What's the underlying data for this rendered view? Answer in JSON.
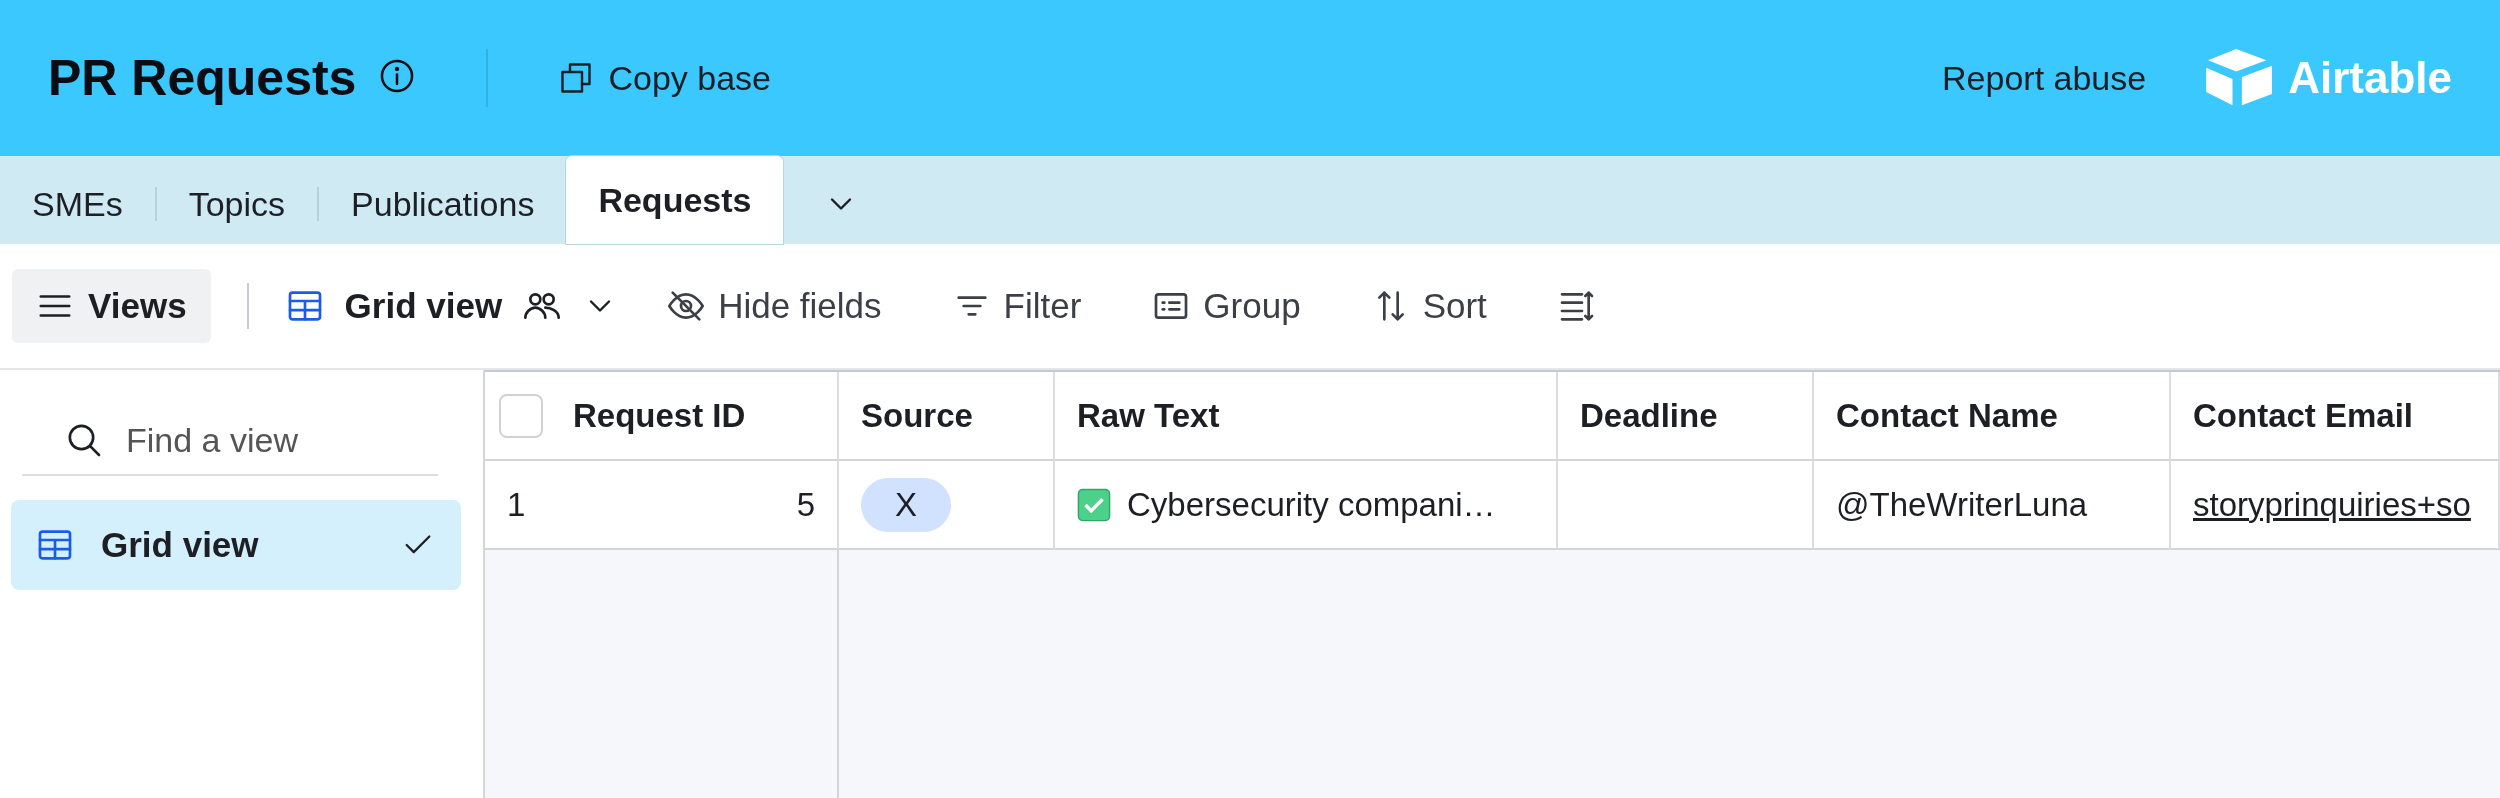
{
  "header": {
    "title": "PR Requests",
    "copy_base": "Copy base",
    "report_abuse": "Report abuse",
    "logo_text": "Airtable"
  },
  "tables": [
    {
      "label": "SMEs",
      "selected": false
    },
    {
      "label": "Topics",
      "selected": false
    },
    {
      "label": "Publications",
      "selected": false
    },
    {
      "label": "Requests",
      "selected": true
    }
  ],
  "toolbar": {
    "views_button": "Views",
    "view_name": "Grid view",
    "items": [
      {
        "kind": "hide",
        "label": "Hide fields"
      },
      {
        "kind": "filter",
        "label": "Filter"
      },
      {
        "kind": "group",
        "label": "Group"
      },
      {
        "kind": "sort",
        "label": "Sort"
      },
      {
        "kind": "row_height"
      }
    ]
  },
  "sidebar": {
    "search_placeholder": "Find a view",
    "views": [
      {
        "label": "Grid view",
        "selected": true
      }
    ]
  },
  "table": {
    "select_all_checked": false,
    "columns": [
      "Request ID",
      "Source",
      "Raw Text",
      "Deadline",
      "Contact Name",
      "Contact Email"
    ],
    "rows": [
      {
        "row_number": "1",
        "request_id": "5",
        "source": "X",
        "raw_text": "Cybersecurity compani…",
        "contact_name": "@TheWriterLuna",
        "contact_email": "storyprinquiries+so"
      }
    ]
  }
}
